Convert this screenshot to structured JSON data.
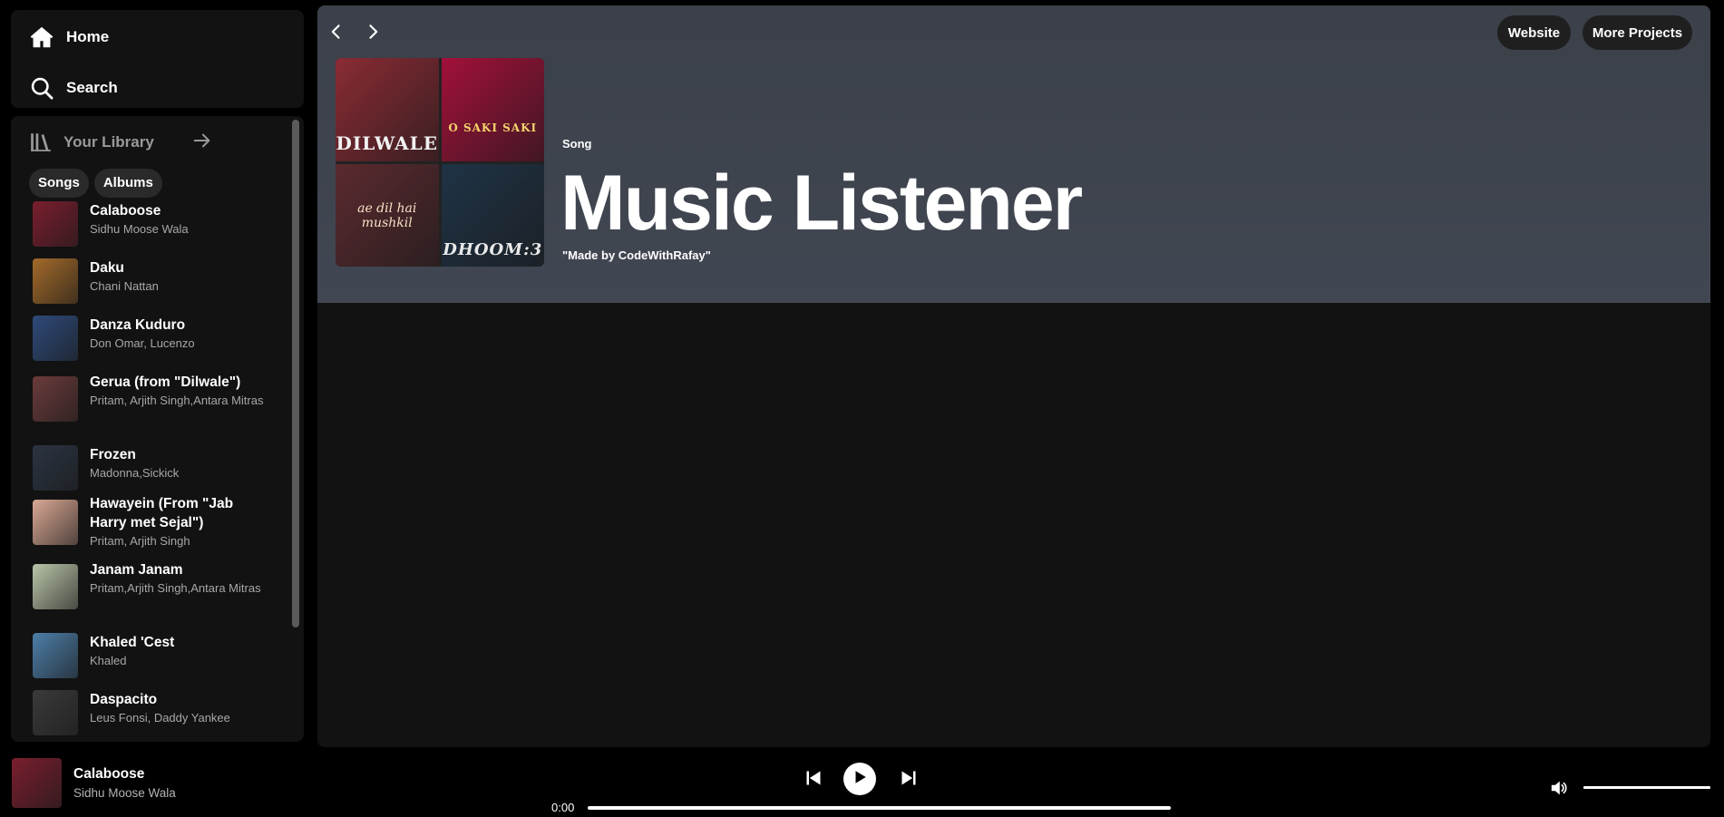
{
  "sidebar": {
    "nav": [
      {
        "label": "Home",
        "icon": "home-icon"
      },
      {
        "label": "Search",
        "icon": "search-icon"
      }
    ],
    "library": {
      "title": "Your Library",
      "icon": "library-icon",
      "arrow_icon": "arrow-right-icon",
      "chips": [
        "Songs",
        "Albums"
      ],
      "songs": [
        {
          "title": "Calaboose",
          "artist": "Sidhu Moose Wala",
          "color": "#7a1e2e"
        },
        {
          "title": "Daku",
          "artist": "Chani Nattan",
          "color": "#a36a2a"
        },
        {
          "title": "Danza Kuduro",
          "artist": "Don Omar, Lucenzo",
          "color": "#2e4a7a"
        },
        {
          "title": "Gerua (from \"Dilwale\")",
          "artist": "Pritam, Arjith Singh,Antara Mitras",
          "color": "#6b3b3b"
        },
        {
          "title": "Frozen",
          "artist": "Madonna,Sickick",
          "color": "#2b3442"
        },
        {
          "title": "Hawayein (From \"Jab Harry met Sejal\")",
          "artist": "Pritam, Arjith Singh",
          "color": "#d9a894"
        },
        {
          "title": "Janam Janam",
          "artist": "Pritam,Arjith Singh,Antara Mitras",
          "color": "#b9c4a8"
        },
        {
          "title": "Khaled 'Cest",
          "artist": "Khaled",
          "color": "#4d7ea8"
        },
        {
          "title": "Daspacito",
          "artist": "Leus Fonsi, Daddy Yankee",
          "color": "#3a3a3a"
        }
      ]
    }
  },
  "main": {
    "nav": {
      "back_icon": "chevron-left-icon",
      "forward_icon": "chevron-right-icon"
    },
    "buttons": {
      "website": "Website",
      "more_projects": "More Projects"
    },
    "hero": {
      "type": "Song",
      "title": "Music Listener",
      "subtitle": "\"Made by CodeWithRafay\"",
      "tiles": [
        {
          "caption": "DILWALE",
          "color": "#8a2b34"
        },
        {
          "caption": "O SAKI SAKI",
          "color": "#a2103a"
        },
        {
          "caption": "ae dil hai mushkil",
          "color": "#5a2a2f"
        },
        {
          "caption": "DHOOM:3",
          "color": "#1f3346"
        }
      ]
    }
  },
  "player": {
    "now_playing": {
      "title": "Calaboose",
      "artist": "Sidhu Moose Wala",
      "cover_color": "#7a1e2e"
    },
    "controls": {
      "prev_icon": "skip-previous-icon",
      "play_icon": "play-icon",
      "next_icon": "skip-next-icon"
    },
    "current_time": "0:00",
    "progress": 0,
    "volume_icon": "volume-icon",
    "volume": 1.0
  }
}
